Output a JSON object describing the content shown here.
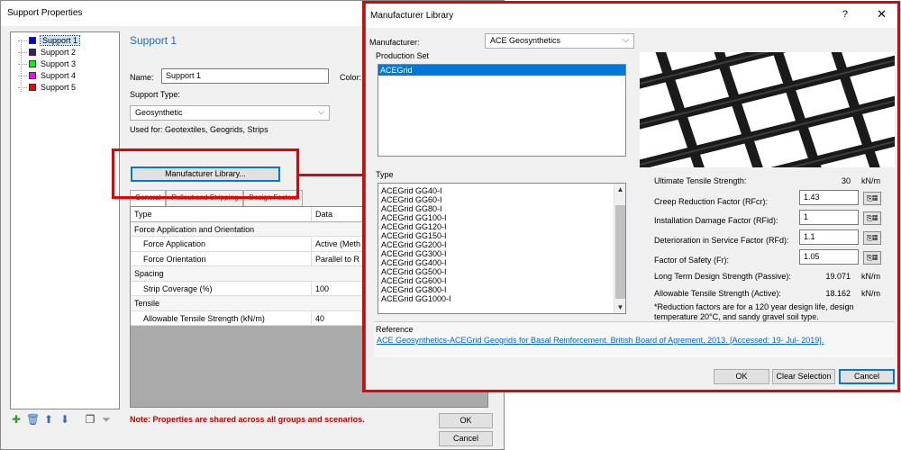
{
  "support_props": {
    "title": "Support Properties",
    "tree": [
      {
        "label": "Support 1",
        "color": "#0000ff"
      },
      {
        "label": "Support 2",
        "color": "#3d1a78"
      },
      {
        "label": "Support 3",
        "color": "#00ff00"
      },
      {
        "label": "Support 4",
        "color": "#ff00ff"
      },
      {
        "label": "Support 5",
        "color": "#ff0000"
      }
    ],
    "heading": "Support 1",
    "name_label": "Name:",
    "name_value": "Support 1",
    "color_label": "Color:",
    "support_type_label": "Support Type:",
    "support_type_value": "Geosynthetic",
    "used_for": "Used for: Geotextiles, Geogrids, Strips",
    "manufacturer_library_btn": "Manufacturer Library...",
    "tabs": [
      "General",
      "Pullout and Stripping",
      "Design Factors"
    ],
    "grid_header": {
      "type": "Type",
      "data": "Data"
    },
    "grid_rows": [
      {
        "kind": "group",
        "type": "Force Application and Orientation",
        "data": ""
      },
      {
        "kind": "item",
        "type": "Force Application",
        "data": "Active (Meth"
      },
      {
        "kind": "item",
        "type": "Force Orientation",
        "data": "Parallel to R"
      },
      {
        "kind": "group",
        "type": "Spacing",
        "data": ""
      },
      {
        "kind": "item",
        "type": "Strip Coverage (%)",
        "data": "100"
      },
      {
        "kind": "group",
        "type": "Tensile",
        "data": ""
      },
      {
        "kind": "item",
        "type": "Allowable Tensile Strength (kN/m)",
        "data": "40"
      }
    ],
    "note": "Note: Properties are shared across all groups and scenarios.",
    "ok": "OK",
    "cancel": "Cancel",
    "icons": [
      "add-icon",
      "delete-icon",
      "move-up-icon",
      "move-down-icon",
      "copy-icon",
      "filter-icon"
    ]
  },
  "manufacturer_library": {
    "title": "Manufacturer Library",
    "help_glyph": "?",
    "close_glyph": "✕",
    "manufacturer_label": "Manufacturer:",
    "manufacturer_value": "ACE Geosynthetics",
    "production_set_label": "Production Set",
    "production_set_items": [
      "ACEGrid"
    ],
    "type_label": "Type",
    "type_items": [
      "ACEGrid GG40-I",
      "ACEGrid GG60-I",
      "ACEGrid GG80-I",
      "ACEGrid GG100-I",
      "ACEGrid GG120-I",
      "ACEGrid GG150-I",
      "ACEGrid GG200-I",
      "ACEGrid GG300-I",
      "ACEGrid GG400-I",
      "ACEGrid GG500-I",
      "ACEGrid GG600-I",
      "ACEGrid GG800-I",
      "ACEGrid GG1000-I"
    ],
    "ultimate_label": "Ultimate Tensile Strength:",
    "ultimate_value": "30",
    "unit": "kN/m",
    "rfcr_label": "Creep Reduction Factor (RFcr):",
    "rfcr_value": "1.43",
    "rfid_label": "Installation Damage Factor (RFid):",
    "rfid_value": "1",
    "rfd_label": "Deterioration in Service Factor (RFd):",
    "rfd_value": "1.1",
    "fr_label": "Factor of Safety (Fr):",
    "fr_value": "1.05",
    "ltds_label": "Long Term Design Strength (Passive):",
    "ltds_value": "19.071",
    "ats_label": "Allowable Tensile Strength (Active):",
    "ats_value": "18.162",
    "footnote": "*Reduction factors are for a 120 year design life, design temperature 20°C, and sandy gravel soil type.",
    "reference_label": "Reference",
    "reference_link": "ACE Geosynthetics-ACEGrid Geogrids for Basal Reinforcement. British Board of Agrement, 2013. [Accessed: 19- Jul- 2019].",
    "ok": "OK",
    "clear_selection": "Clear Selection",
    "cancel": "Cancel"
  },
  "colors": {
    "highlight": "#e60000",
    "accent": "#0078d7",
    "heading": "#1f6fb8",
    "note": "#c00000"
  }
}
